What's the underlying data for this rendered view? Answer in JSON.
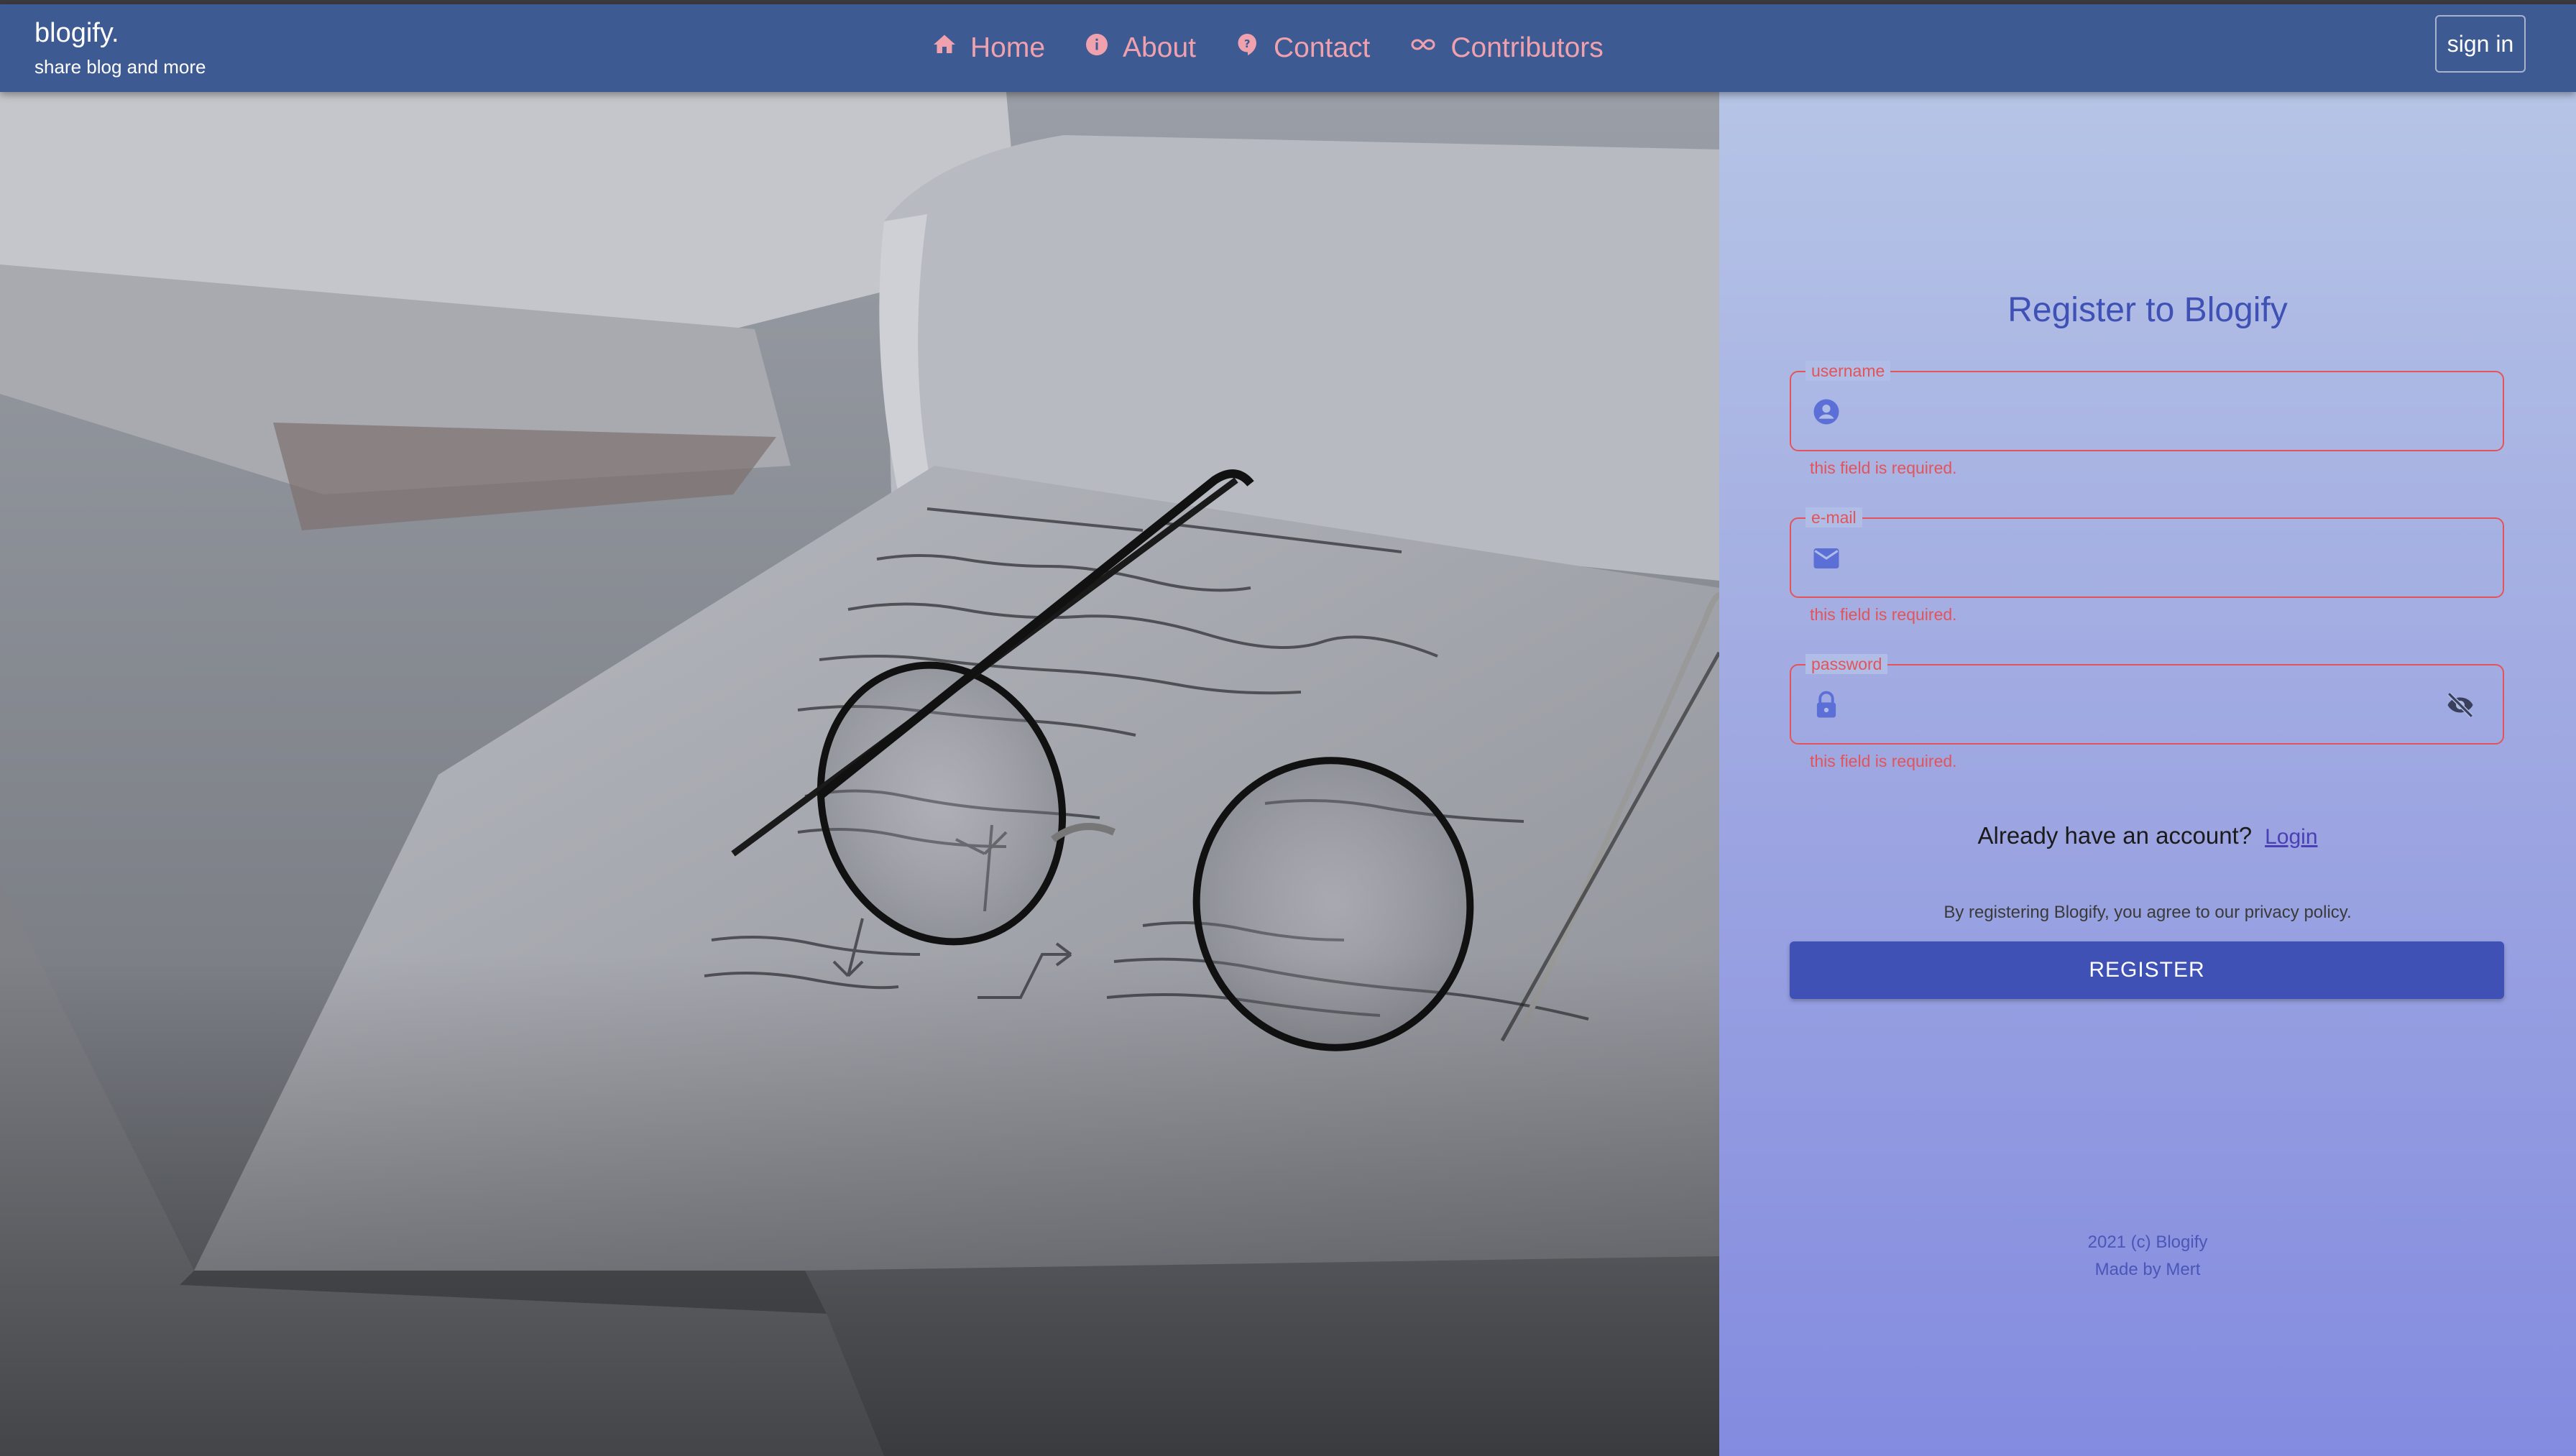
{
  "header": {
    "brand_title": "blogify.",
    "brand_subtitle": "share blog and more",
    "nav": [
      {
        "label": "Home",
        "icon": "home-icon"
      },
      {
        "label": "About",
        "icon": "info-icon"
      },
      {
        "label": "Contact",
        "icon": "help-icon"
      },
      {
        "label": "Contributors",
        "icon": "infinity-icon"
      }
    ],
    "signin_label": "sign in"
  },
  "register": {
    "title": "Register to Blogify",
    "fields": [
      {
        "label": "username",
        "value": "",
        "icon": "user-circle-icon",
        "error": "this field is required."
      },
      {
        "label": "e-mail",
        "value": "",
        "icon": "mail-icon",
        "error": "this field is required."
      },
      {
        "label": "password",
        "value": "",
        "icon": "lock-icon",
        "error": "this field is required.",
        "toggle_icon": "eye-off-icon"
      }
    ],
    "already_text": "Already have an account?",
    "login_link": "Login",
    "agreement": "By registering Blogify, you agree to our privacy policy.",
    "register_button": "REGISTER"
  },
  "footer": {
    "line1": "2021 (c) Blogify",
    "line2": "Made by Mert"
  },
  "colors": {
    "header_bg": "#3e5a93",
    "nav_text": "#f0a1ae",
    "accent": "#3f51b5",
    "error": "#e3545a"
  }
}
